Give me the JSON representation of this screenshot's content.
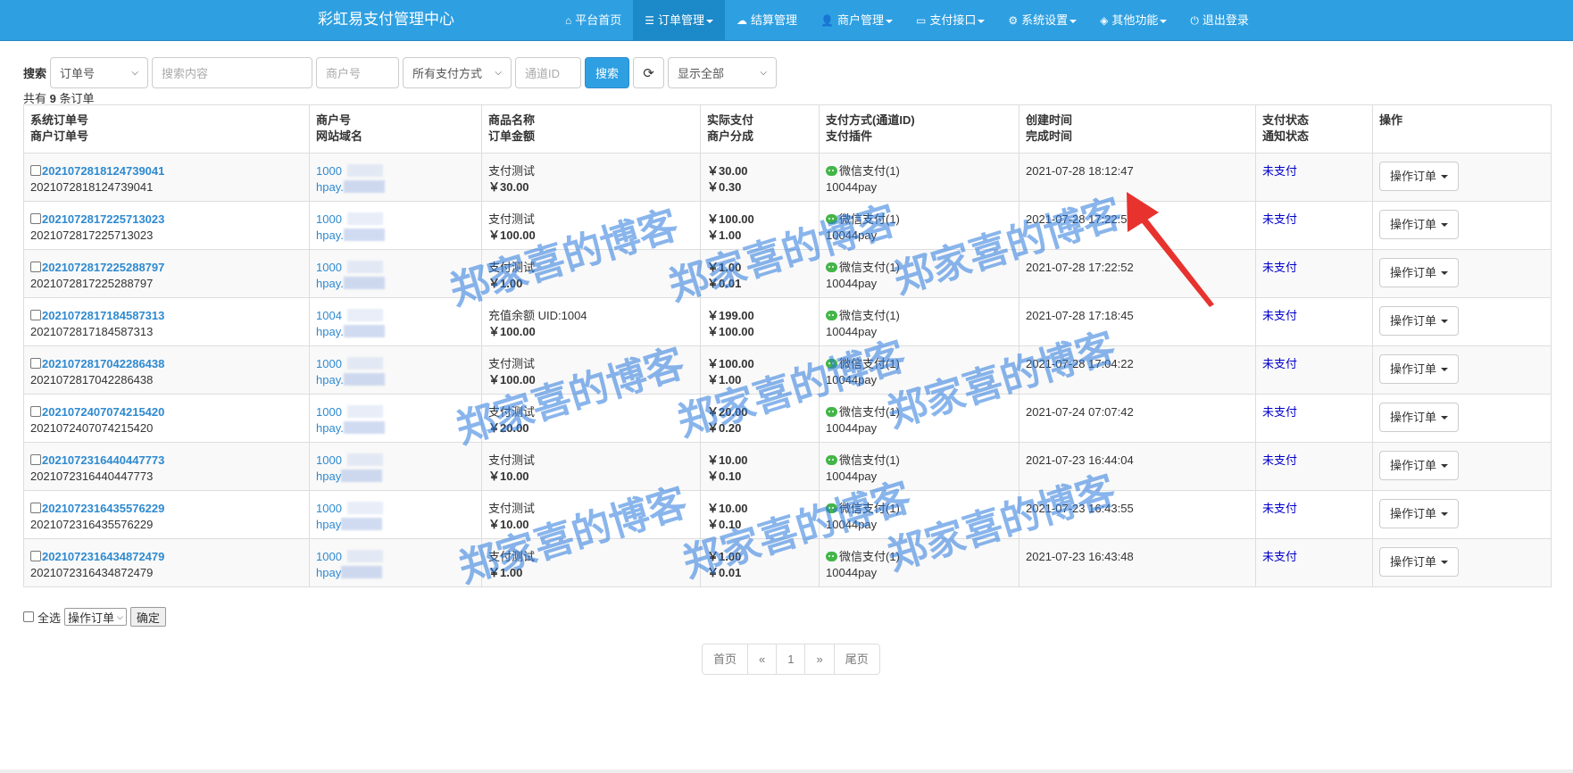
{
  "brand": "彩虹易支付管理中心",
  "nav": [
    {
      "icon": "home-icon",
      "glyph": "⌂",
      "label": "平台首页",
      "dropdown": false,
      "active": false
    },
    {
      "icon": "list-icon",
      "glyph": "☰",
      "label": "订单管理",
      "dropdown": true,
      "active": true
    },
    {
      "icon": "cloud-icon",
      "glyph": "☁",
      "label": "结算管理",
      "dropdown": false,
      "active": false
    },
    {
      "icon": "user-icon",
      "glyph": "👤",
      "label": "商户管理",
      "dropdown": true,
      "active": false
    },
    {
      "icon": "card-icon",
      "glyph": "▭",
      "label": "支付接口",
      "dropdown": true,
      "active": false
    },
    {
      "icon": "gear-icon",
      "glyph": "⚙",
      "label": "系统设置",
      "dropdown": true,
      "active": false
    },
    {
      "icon": "cube-icon",
      "glyph": "◈",
      "label": "其他功能",
      "dropdown": true,
      "active": false
    },
    {
      "icon": "power-icon",
      "glyph": "⏻",
      "label": "退出登录",
      "dropdown": false,
      "active": false
    }
  ],
  "search": {
    "label": "搜索",
    "field_select": "订单号",
    "keyword_placeholder": "搜索内容",
    "merchant_placeholder": "商户号",
    "paytype_select": "所有支付方式",
    "channel_placeholder": "通道ID",
    "submit_label": "搜索",
    "refresh_glyph": "⟳",
    "display_select": "显示全部"
  },
  "count": {
    "prefix": "共有 ",
    "number": "9",
    "suffix": " 条订单"
  },
  "headers": [
    {
      "line1": "系统订单号",
      "line2": "商户订单号"
    },
    {
      "line1": "商户号",
      "line2": "网站域名"
    },
    {
      "line1": "商品名称",
      "line2": "订单金额"
    },
    {
      "line1": "实际支付",
      "line2": "商户分成"
    },
    {
      "line1": "支付方式(通道ID)",
      "line2": "支付插件"
    },
    {
      "line1": "创建时间",
      "line2": "完成时间"
    },
    {
      "line1": "支付状态",
      "line2": "通知状态"
    },
    {
      "line1": "",
      "line2": "操作"
    }
  ],
  "orders": [
    {
      "trade_no": "2021072818124739041",
      "out_trade_no": "2021072818124739041",
      "uid": "1000",
      "domain": "hpay.",
      "name": "支付测试",
      "money": "￥30.00",
      "realmoney": "￥30.00",
      "getmoney": "￥0.30",
      "paytype": "微信支付(1)",
      "plugin": "10044pay",
      "addtime": "2021-07-28 18:12:47",
      "endtime": "",
      "status": "未支付",
      "notify": "",
      "action": "操作订单"
    },
    {
      "trade_no": "2021072817225713023",
      "out_trade_no": "2021072817225713023",
      "uid": "1000",
      "domain": "hpay.",
      "name": "支付测试",
      "money": "￥100.00",
      "realmoney": "￥100.00",
      "getmoney": "￥1.00",
      "paytype": "微信支付(1)",
      "plugin": "10044pay",
      "addtime": "2021-07-28 17:22:57",
      "endtime": "",
      "status": "未支付",
      "notify": "",
      "action": "操作订单"
    },
    {
      "trade_no": "2021072817225288797",
      "out_trade_no": "2021072817225288797",
      "uid": "1000",
      "domain": "hpay.",
      "name": "支付测试",
      "money": "￥1.00",
      "realmoney": "￥1.00",
      "getmoney": "￥0.01",
      "paytype": "微信支付(1)",
      "plugin": "10044pay",
      "addtime": "2021-07-28 17:22:52",
      "endtime": "",
      "status": "未支付",
      "notify": "",
      "action": "操作订单"
    },
    {
      "trade_no": "2021072817184587313",
      "out_trade_no": "2021072817184587313",
      "uid": "1004",
      "domain": "hpay.",
      "name": "充值余额 UID:1004",
      "money": "￥100.00",
      "realmoney": "￥199.00",
      "getmoney": "￥100.00",
      "paytype": "微信支付(1)",
      "plugin": "10044pay",
      "addtime": "2021-07-28 17:18:45",
      "endtime": "",
      "status": "未支付",
      "notify": "",
      "action": "操作订单"
    },
    {
      "trade_no": "2021072817042286438",
      "out_trade_no": "2021072817042286438",
      "uid": "1000",
      "domain": "hpay.",
      "name": "支付测试",
      "money": "￥100.00",
      "realmoney": "￥100.00",
      "getmoney": "￥1.00",
      "paytype": "微信支付(1)",
      "plugin": "10044pay",
      "addtime": "2021-07-28 17:04:22",
      "endtime": "",
      "status": "未支付",
      "notify": "",
      "action": "操作订单"
    },
    {
      "trade_no": "2021072407074215420",
      "out_trade_no": "2021072407074215420",
      "uid": "1000",
      "domain": "hpay.",
      "name": "支付测试",
      "money": "￥20.00",
      "realmoney": "￥20.00",
      "getmoney": "￥0.20",
      "paytype": "微信支付(1)",
      "plugin": "10044pay",
      "addtime": "2021-07-24 07:07:42",
      "endtime": "",
      "status": "未支付",
      "notify": "",
      "action": "操作订单"
    },
    {
      "trade_no": "2021072316440447773",
      "out_trade_no": "2021072316440447773",
      "uid": "1000",
      "domain": "hpay",
      "name": "支付测试",
      "money": "￥10.00",
      "realmoney": "￥10.00",
      "getmoney": "￥0.10",
      "paytype": "微信支付(1)",
      "plugin": "10044pay",
      "addtime": "2021-07-23 16:44:04",
      "endtime": "",
      "status": "未支付",
      "notify": "",
      "action": "操作订单"
    },
    {
      "trade_no": "2021072316435576229",
      "out_trade_no": "2021072316435576229",
      "uid": "1000",
      "domain": "hpay",
      "name": "支付测试",
      "money": "￥10.00",
      "realmoney": "￥10.00",
      "getmoney": "￥0.10",
      "paytype": "微信支付(1)",
      "plugin": "10044pay",
      "addtime": "2021-07-23 16:43:55",
      "endtime": "",
      "status": "未支付",
      "notify": "",
      "action": "操作订单"
    },
    {
      "trade_no": "2021072316434872479",
      "out_trade_no": "2021072316434872479",
      "uid": "1000",
      "domain": "hpay",
      "name": "支付测试",
      "money": "￥1.00",
      "realmoney": "￥1.00",
      "getmoney": "￥0.01",
      "paytype": "微信支付(1)",
      "plugin": "10044pay",
      "addtime": "2021-07-23 16:43:48",
      "endtime": "",
      "status": "未支付",
      "notify": "",
      "action": "操作订单"
    }
  ],
  "bulk": {
    "select_all": "全选",
    "action_select": "操作订单",
    "confirm": "确定"
  },
  "pager": [
    "首页",
    "«",
    "1",
    "»",
    "尾页"
  ],
  "watermark": "郑家喜的博客",
  "colors": {
    "navbar": "#2ea0e2",
    "nav_active": "#1c89c8",
    "link": "#2e8ad0",
    "status_unpaid": "#0000cc",
    "wechat": "#44b549",
    "arrow": "#e8322e",
    "watermark": "#2878dc"
  }
}
